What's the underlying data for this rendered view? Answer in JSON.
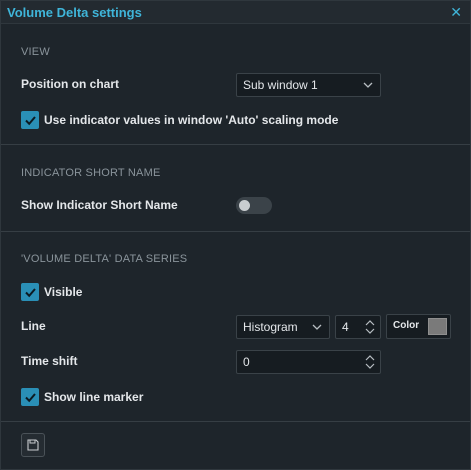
{
  "window": {
    "title": "Volume Delta settings",
    "close_icon": "close-icon"
  },
  "view": {
    "heading": "VIEW",
    "position_label": "Position on chart",
    "position_value": "Sub window 1",
    "auto_scaling_label": "Use indicator values in window 'Auto' scaling mode",
    "auto_scaling_checked": true
  },
  "short_name": {
    "heading": "INDICATOR SHORT NAME",
    "show_label": "Show Indicator Short Name",
    "show_enabled": false
  },
  "series": {
    "heading": "'VOLUME DELTA' DATA SERIES",
    "visible_label": "Visible",
    "visible_checked": true,
    "line_label": "Line",
    "line_type": "Histogram",
    "line_width": "4",
    "color_label": "Color",
    "color_value": "#7a7a7a",
    "time_shift_label": "Time shift",
    "time_shift_value": "0",
    "line_marker_label": "Show line marker",
    "line_marker_checked": true
  },
  "footer": {
    "save_icon": "save-icon"
  },
  "colors": {
    "accent": "#2a8fb6",
    "title": "#3fb5d9",
    "background": "#1e252b"
  }
}
